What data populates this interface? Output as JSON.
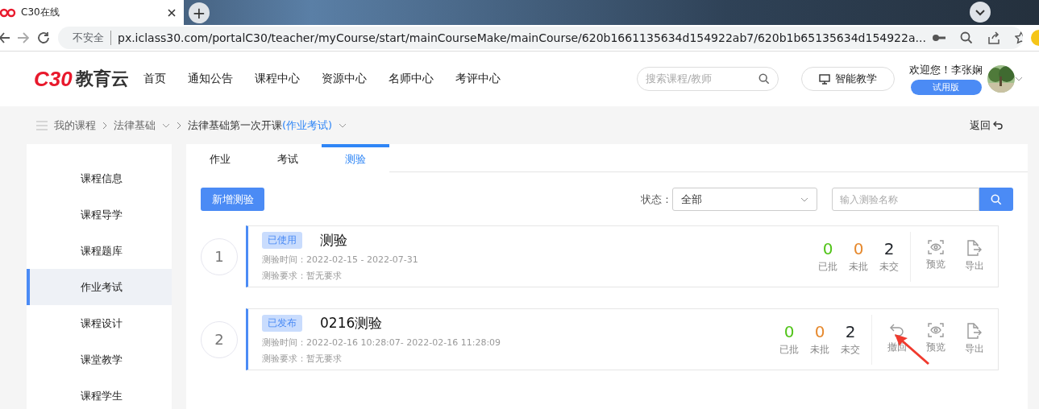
{
  "browser": {
    "tab_title": "C30在线",
    "new_tab": "+",
    "security": "不安全",
    "url": "px.iclass30.com/portalC30/teacher/myCourse/start/mainCourseMake/mainCourse/620b1661135634d154922ab7/620b1b65135634d154922a..."
  },
  "header": {
    "logo_mark": "C30",
    "logo_text": "教育云",
    "nav": [
      {
        "label": "首页"
      },
      {
        "label": "通知公告"
      },
      {
        "label": "课程中心"
      },
      {
        "label": "资源中心"
      },
      {
        "label": "名师中心"
      },
      {
        "label": "考评中心"
      }
    ],
    "search_placeholder": "搜索课程/教师",
    "smart_button": "智能教学",
    "welcome": "欢迎您！李张娴",
    "trial_badge": "试用版"
  },
  "breadcrumb": {
    "items": [
      "我的课程",
      "法律基础",
      "法律基础第一次开课"
    ],
    "current_tag": "(作业考试)",
    "back": "返回"
  },
  "sidebar": {
    "items": [
      {
        "label": "课程信息",
        "selected": false
      },
      {
        "label": "课程导学",
        "selected": false
      },
      {
        "label": "课程题库",
        "selected": false
      },
      {
        "label": "作业考试",
        "selected": true
      },
      {
        "label": "课程设计",
        "selected": false
      },
      {
        "label": "课堂教学",
        "selected": false
      },
      {
        "label": "课程学生",
        "selected": false
      }
    ]
  },
  "tabs": [
    {
      "label": "作业",
      "selected": false
    },
    {
      "label": "考试",
      "selected": false
    },
    {
      "label": "测验",
      "selected": true
    }
  ],
  "toolbar": {
    "add_button": "新增测验",
    "status_label": "状态：",
    "status_value": "全部",
    "search_placeholder": "输入测验名称"
  },
  "quizzes": [
    {
      "index": "1",
      "status": "已使用",
      "title": "测验",
      "time_label": "测验时间：",
      "time": "2022-02-15 - 2022-07-31",
      "req_label": "测验要求：",
      "req": "暂无要求",
      "stats": [
        {
          "value": "0",
          "label": "已批",
          "color": "#52c41a"
        },
        {
          "value": "0",
          "label": "未批",
          "color": "#e6892e"
        },
        {
          "value": "2",
          "label": "未交",
          "color": "#1f2329"
        }
      ],
      "actions": [
        {
          "kind": "preview",
          "label": "预览"
        },
        {
          "kind": "export",
          "label": "导出"
        }
      ]
    },
    {
      "index": "2",
      "status": "已发布",
      "title": "0216测验",
      "time_label": "测验时间：",
      "time": "2022-02-16 10:28:07- 2022-02-16 11:28:09",
      "req_label": "测验要求：",
      "req": "暂无要求",
      "stats": [
        {
          "value": "0",
          "label": "已批",
          "color": "#52c41a"
        },
        {
          "value": "0",
          "label": "未批",
          "color": "#e6892e"
        },
        {
          "value": "2",
          "label": "未交",
          "color": "#1f2329"
        }
      ],
      "actions": [
        {
          "kind": "withdraw",
          "label": "撤回"
        },
        {
          "kind": "preview",
          "label": "预览"
        },
        {
          "kind": "export",
          "label": "导出"
        }
      ]
    }
  ]
}
